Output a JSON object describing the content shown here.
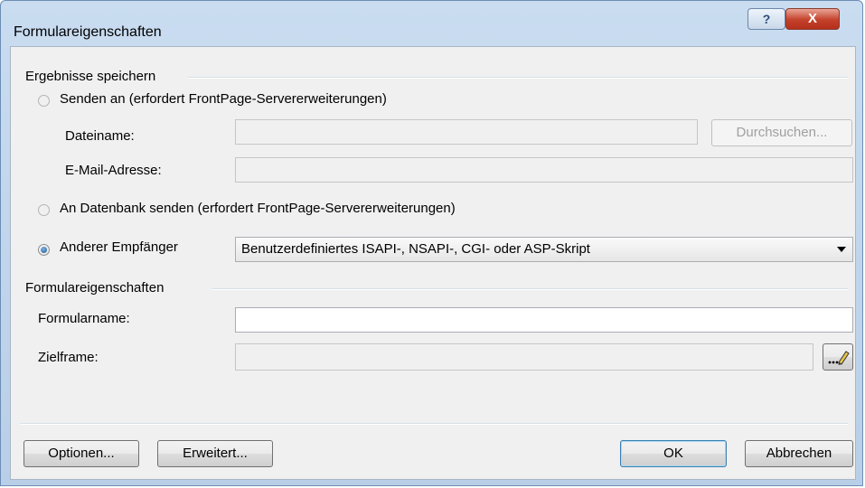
{
  "window": {
    "title": "Formulareigenschaften"
  },
  "titlebar_buttons": {
    "help": "?",
    "close": "X"
  },
  "save_results": {
    "group_label": "Ergebnisse speichern",
    "send_to_label": "Senden an (erfordert FrontPage-Servererweiterungen)",
    "filename_label": "Dateiname:",
    "filename_value": "",
    "browse_button": "Durchsuchen...",
    "email_label": "E-Mail-Adresse:",
    "email_value": "",
    "database_label": "An Datenbank senden (erfordert FrontPage-Servererweiterungen)",
    "other_recipient_label": "Anderer Empfänger",
    "other_recipient_selected": "Benutzerdefiniertes ISAPI-, NSAPI-, CGI- oder ASP-Skript"
  },
  "form_properties": {
    "group_label": "Formulareigenschaften",
    "form_name_label": "Formularname:",
    "form_name_value": "",
    "target_frame_label": "Zielframe:",
    "target_frame_value": ""
  },
  "footer": {
    "options_button": "Optionen...",
    "advanced_button": "Erweitert...",
    "ok_button": "OK",
    "cancel_button": "Abbrechen"
  },
  "icons": {
    "target_frame_button": "pencil-icon"
  }
}
